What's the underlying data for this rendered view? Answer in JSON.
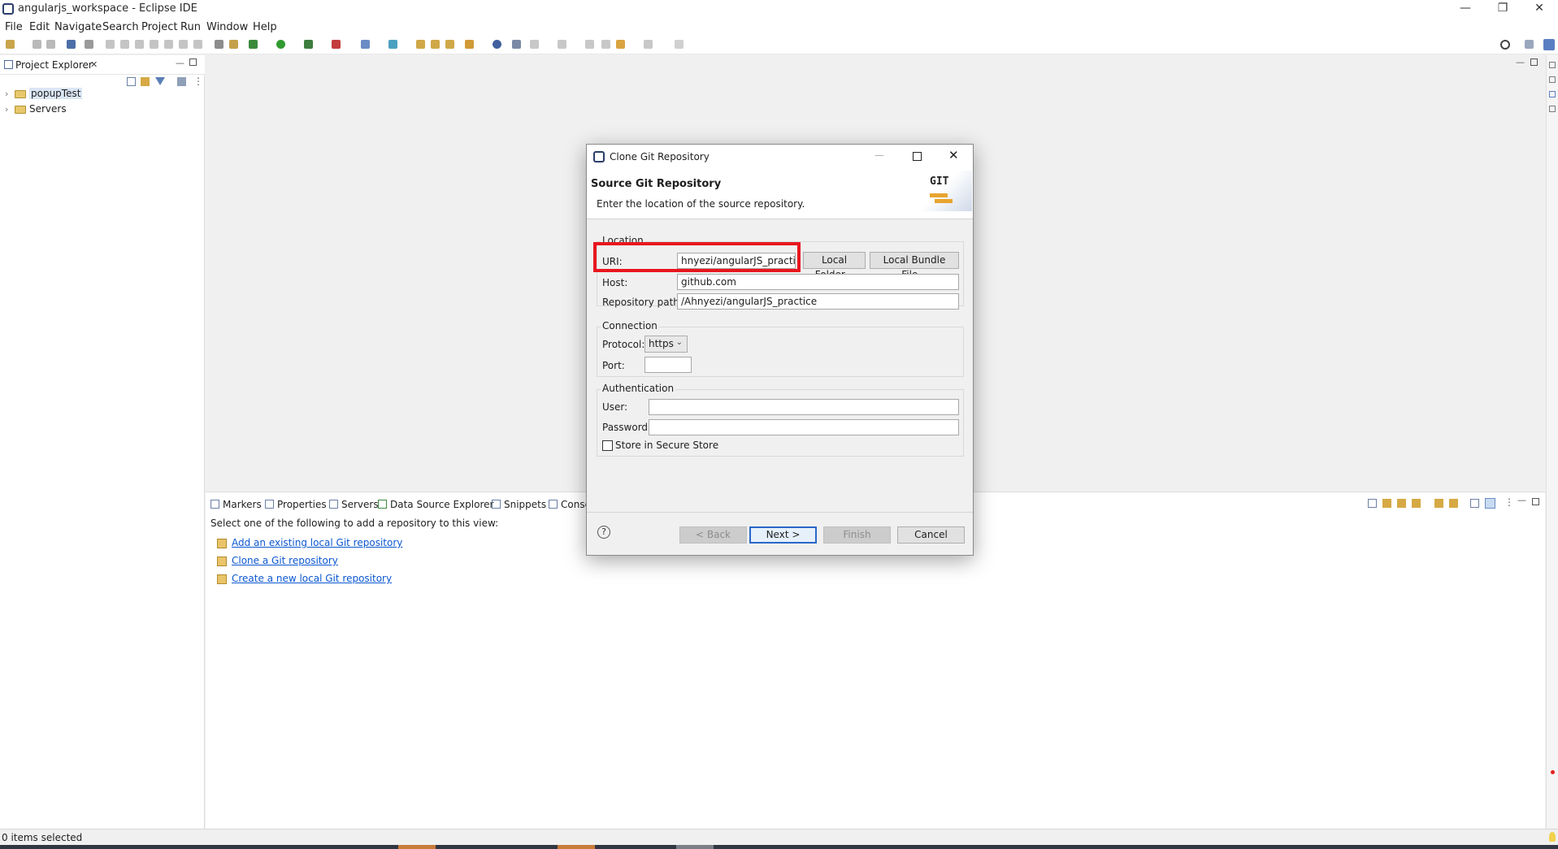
{
  "window": {
    "title": "angularjs_workspace - Eclipse IDE",
    "minimize": "—",
    "restore": "❐",
    "close": "✕"
  },
  "menu": [
    "File",
    "Edit",
    "Navigate",
    "Search",
    "Project",
    "Run",
    "Window",
    "Help"
  ],
  "explorer": {
    "title": "Project Explorer",
    "close": "✕",
    "items": [
      {
        "label": "popupTest"
      },
      {
        "label": "Servers"
      }
    ]
  },
  "bottom": {
    "tabs": [
      "Markers",
      "Properties",
      "Servers",
      "Data Source Explorer",
      "Snippets",
      "Conso"
    ],
    "intro": "Select one of the following to add a repository to this view:",
    "links": [
      "Add an existing local Git repository",
      "Clone a Git repository",
      "Create a new local Git repository"
    ]
  },
  "status": {
    "text": "0 items selected"
  },
  "dialog": {
    "title": "Clone Git Repository",
    "heading": "Source Git Repository",
    "subheading": "Enter the location of the source repository.",
    "git_logo": "GIT",
    "location_group": "Location",
    "uri_label": "URI:",
    "uri_value": "hnyezi/angularJS_practice",
    "local_folder_btn": "Local Folder...",
    "local_bundle_btn": "Local Bundle File...",
    "host_label": "Host:",
    "host_value": "github.com",
    "repo_path_label": "Repository path:",
    "repo_path_value": "/Ahnyezi/angularJS_practice",
    "connection_group": "Connection",
    "protocol_label": "Protocol:",
    "protocol_value": "https",
    "port_label": "Port:",
    "port_value": "",
    "auth_group": "Authentication",
    "user_label": "User:",
    "user_value": "",
    "password_label": "Password:",
    "password_value": "",
    "store_label": "Store in Secure Store",
    "store_checked": false,
    "help": "?",
    "back_btn": "< Back",
    "next_btn": "Next >",
    "finish_btn": "Finish",
    "cancel_btn": "Cancel",
    "highlight_color": "#e8161f"
  }
}
